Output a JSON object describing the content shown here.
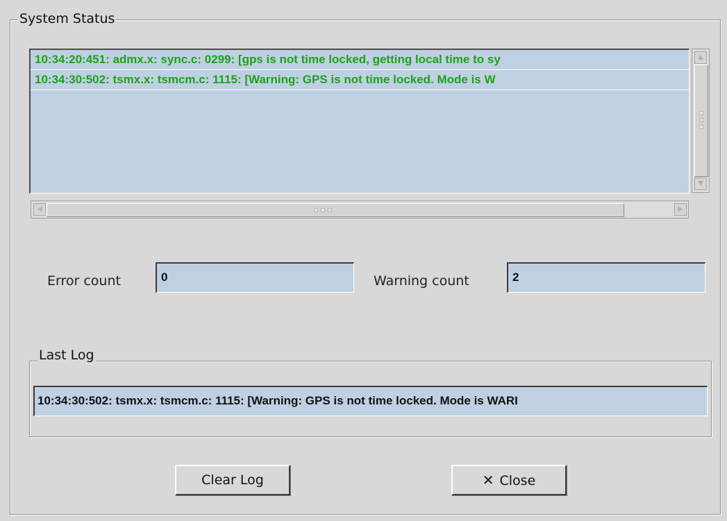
{
  "panel": {
    "title": "System Status"
  },
  "log": {
    "lines": [
      "10:34:20:451: admx.x: sync.c: 0299: [gps is not time locked, getting local time to sy",
      "10:34:30:502: tsmx.x: tsmcm.c: 1115: [Warning:  GPS is not time locked.  Mode is W"
    ],
    "text_color": "#1aa31a",
    "background": "#bfd0e2"
  },
  "counts": {
    "error_label": "Error count",
    "error_value": "0",
    "warning_label": "Warning count",
    "warning_value": "2"
  },
  "last_log": {
    "title": "Last Log",
    "value": "10:34:30:502: tsmx.x: tsmcm.c: 1115: [Warning:  GPS is not time locked.  Mode is WARI"
  },
  "buttons": {
    "clear_label": "Clear Log",
    "close_label": "Close",
    "close_icon": "x-icon"
  }
}
